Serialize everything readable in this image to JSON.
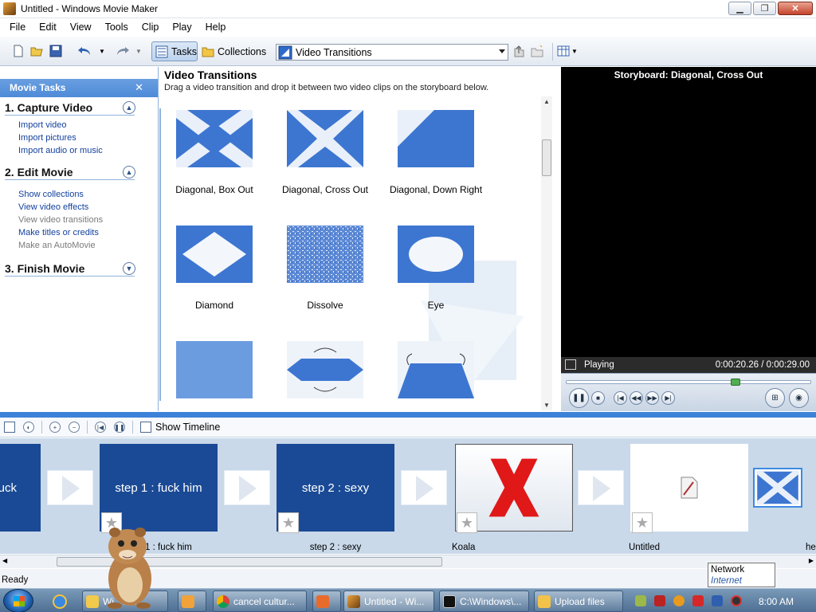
{
  "window": {
    "title": "Untitled - Windows Movie Maker"
  },
  "menu": [
    "File",
    "Edit",
    "View",
    "Tools",
    "Clip",
    "Play",
    "Help"
  ],
  "toolbar": {
    "tasks_label": "Tasks",
    "collections_label": "Collections",
    "collection_select": "Video Transitions"
  },
  "task_pane": {
    "header": "Movie Tasks",
    "sections": [
      {
        "title": "1. Capture Video",
        "links": [
          {
            "label": "Import video",
            "enabled": true
          },
          {
            "label": "Import pictures",
            "enabled": true
          },
          {
            "label": "Import audio or music",
            "enabled": true
          }
        ]
      },
      {
        "title": "2. Edit Movie",
        "links": [
          {
            "label": "Show collections",
            "enabled": true
          },
          {
            "label": "View video effects",
            "enabled": true
          },
          {
            "label": "View video transitions",
            "enabled": false
          },
          {
            "label": "Make titles or credits",
            "enabled": true
          },
          {
            "label": "Make an AutoMovie",
            "enabled": false
          }
        ]
      },
      {
        "title": "3. Finish Movie",
        "links": []
      }
    ]
  },
  "transitions": {
    "title": "Video Transitions",
    "subtitle": "Drag a video transition and drop it between two video clips on the storyboard below.",
    "items": [
      {
        "label": "Diagonal, Box Out"
      },
      {
        "label": "Diagonal, Cross Out"
      },
      {
        "label": "Diagonal, Down Right"
      },
      {
        "label": "Diamond"
      },
      {
        "label": "Dissolve"
      },
      {
        "label": "Eye"
      },
      {
        "label": ""
      },
      {
        "label": ""
      },
      {
        "label": ""
      }
    ]
  },
  "preview": {
    "title": "Storyboard: Diagonal, Cross Out",
    "status": "Playing",
    "time": "0:00:20.26 / 0:00:29.00",
    "progress": 0.7
  },
  "storyboard_toolbar": {
    "show_timeline": "Show Timeline"
  },
  "storyboard": {
    "clips": [
      {
        "text": "uck",
        "caption": ""
      },
      {
        "text": "step 1 : fuck him",
        "caption": "step 1 : fuck him"
      },
      {
        "text": "step 2 : sexy",
        "caption": "step 2 : sexy"
      },
      {
        "text": "",
        "caption": "Koala"
      },
      {
        "text": "",
        "caption": "Untitled"
      },
      {
        "text": "",
        "caption": "he"
      }
    ]
  },
  "status": {
    "text": "Ready"
  },
  "tooltip": {
    "line1": "Network",
    "line2": "Internet access"
  },
  "taskbar": {
    "items": [
      "Wi...ex...",
      "",
      "cancel cultur...",
      "",
      "Untitled - Wi...",
      "C:\\Windows\\...",
      "Upload files"
    ],
    "clock": "8:00 AM"
  }
}
